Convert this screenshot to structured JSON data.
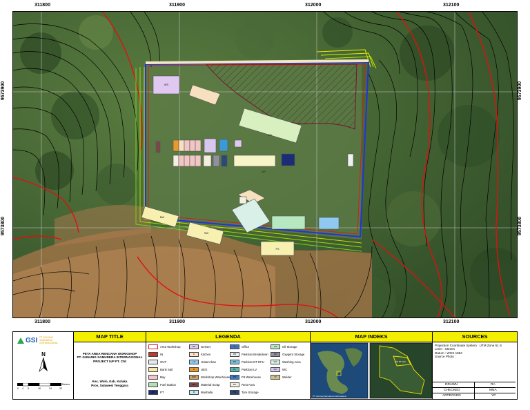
{
  "grid": {
    "easting_labels": [
      "311800",
      "311900",
      "312000",
      "312100"
    ],
    "northing_labels": [
      "9573900",
      "9573800"
    ]
  },
  "map": {
    "area_labels": [
      "BW",
      "SW",
      "FS",
      "AR",
      "AR"
    ],
    "workshop_label": "WS",
    "colors": {
      "boundary": "#2233dd",
      "contour": "#000000",
      "index_contour": "#e01010",
      "area_workshop": "#d02020",
      "hatch": "#7a1030"
    }
  },
  "logo": {
    "mark": "GSI",
    "line1": "PT GUNUNG",
    "line2": "SAMUDERA",
    "line3": "INTERNASIONAL"
  },
  "north": {
    "label": "N"
  },
  "scalebar": {
    "ticks": [
      "0",
      "4",
      "8",
      "16",
      "24",
      "32"
    ],
    "unit": "Meters"
  },
  "map_title": {
    "header": "MAP TITLE",
    "line1": "PETA AREA RENCANA WORKSHOP",
    "line2": "PT. GUNUNG SAMUDERA INTERNASIONAL",
    "line3": "PROJECT IUP PT. CNI",
    "location1": "Kec. Wolo, Kab. Kolaka",
    "location2": "Prov. Sulawesi Tenggara"
  },
  "legend": {
    "header": "LEGENDA",
    "items": [
      {
        "label": "Area Workshop",
        "color": "#ffffff",
        "border": "#d02020",
        "code": ""
      },
      {
        "label": "IN",
        "color": "#c0392b",
        "border": "#444",
        "code": ""
      },
      {
        "label": "OUT",
        "color": "#e8e8e8",
        "border": "#444",
        "code": ""
      },
      {
        "label": "Bank Sail",
        "color": "#f7e9a6",
        "border": "#444",
        "code": ""
      },
      {
        "label": "Bay",
        "color": "#f3c6c6",
        "border": "#444",
        "code": ""
      },
      {
        "label": "Fuel Station",
        "color": "#b5e0b0",
        "border": "#444",
        "code": ""
      },
      {
        "label": "PT",
        "color": "#1c2d74",
        "border": "#444",
        "code": "PT"
      },
      {
        "label": "Genset",
        "color": "#e0c8f0",
        "border": "#444",
        "code": "GS"
      },
      {
        "label": "Kitchen",
        "color": "#ffe0c8",
        "border": "#444",
        "code": "K"
      },
      {
        "label": "Hotam Ikan",
        "color": "#8fc8f0",
        "border": "#444",
        "code": "HI"
      },
      {
        "label": "UEO",
        "color": "#e89a2c",
        "border": "#444",
        "code": "U"
      },
      {
        "label": "Workshop Warehouse",
        "color": "#c9a26a",
        "border": "#444",
        "code": "WW"
      },
      {
        "label": "Material Scrap",
        "color": "#7a4848",
        "border": "#444",
        "code": "MS"
      },
      {
        "label": "Mushalla",
        "color": "#c8e8f4",
        "border": "#444",
        "code": "M"
      },
      {
        "label": "Office",
        "color": "#4070c0",
        "border": "#444",
        "code": "O"
      },
      {
        "label": "Parkiran Breakdown",
        "color": "#eeeeee",
        "border": "#444",
        "code": "PB"
      },
      {
        "label": "Parkiran DT RFU",
        "color": "#7ac0d8",
        "border": "#444",
        "code": "PD"
      },
      {
        "label": "Parkiran LV",
        "color": "#58b8b0",
        "border": "#444",
        "code": "PL"
      },
      {
        "label": "Pit Warehouse",
        "color": "#3a7ac8",
        "border": "#444",
        "code": "PW"
      },
      {
        "label": "Rest Area",
        "color": "#f4efe0",
        "border": "#444",
        "code": "RA"
      },
      {
        "label": "Tyre Storage",
        "color": "#2a4878",
        "border": "#444",
        "code": "TS"
      },
      {
        "label": "Oil Storage",
        "color": "#b8e8c0",
        "border": "#444",
        "code": "OS"
      },
      {
        "label": "Oxygent Storage",
        "color": "#9090a0",
        "border": "#444",
        "code": "OX"
      },
      {
        "label": "Washing Area",
        "color": "#d8f0e8",
        "border": "#444",
        "code": "WA"
      },
      {
        "label": "WC",
        "color": "#d8c8f0",
        "border": "#444",
        "code": "WC"
      },
      {
        "label": "Welder",
        "color": "#d0c090",
        "border": "#444",
        "code": "W"
      }
    ]
  },
  "map_index": {
    "header": "MAP INDEKS",
    "inset_caption": "PT. Gunung Samudera Internasional",
    "site_label": "IUP PT CNI"
  },
  "sources": {
    "header": "SOURCES",
    "line1": "Projection Coordinate System : UTM Zone 51 S",
    "line2": "Linier : Meters",
    "line3": "Datum : WGS 1984",
    "line4": "Source Photo :",
    "rows": [
      {
        "role": "DRAWN",
        "initials": "RA"
      },
      {
        "role": "CHECKED",
        "initials": "MNA"
      },
      {
        "role": "APPROVED",
        "initials": "YP"
      }
    ]
  }
}
